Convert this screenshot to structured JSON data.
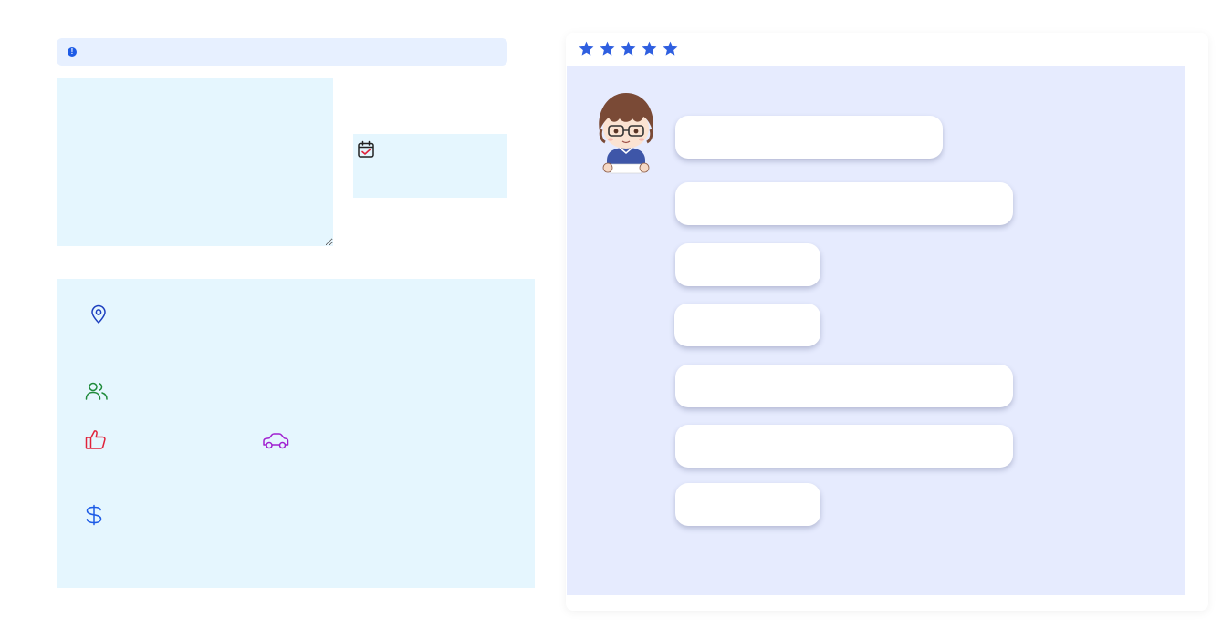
{
  "alert": {
    "text": "",
    "icon": "info-icon",
    "color": "#1d5be6"
  },
  "note_field": {
    "value": "",
    "placeholder": ""
  },
  "date_field": {
    "icon": "calendar-check-icon",
    "value": ""
  },
  "info_panel": {
    "items": [
      {
        "icon": "location-pin-icon",
        "text": "",
        "color": "#1d3fbf"
      },
      {
        "icon": "users-icon",
        "text": "",
        "color": "#1e8a3a"
      },
      {
        "icon": "thumbs-up-icon",
        "text": "",
        "color": "#e0223a"
      },
      {
        "icon": "car-icon",
        "text": "",
        "color": "#a020d0"
      },
      {
        "icon": "dollar-icon",
        "text": "",
        "color": "#1d5be6"
      }
    ]
  },
  "rating": {
    "stars": 5,
    "max": 5,
    "color": "#2f5fe0"
  },
  "chat": {
    "avatar": "chibi-avatar-icon",
    "options": [
      {
        "label": ""
      },
      {
        "label": ""
      },
      {
        "label": ""
      },
      {
        "label": ""
      },
      {
        "label": ""
      },
      {
        "label": ""
      },
      {
        "label": ""
      }
    ]
  }
}
